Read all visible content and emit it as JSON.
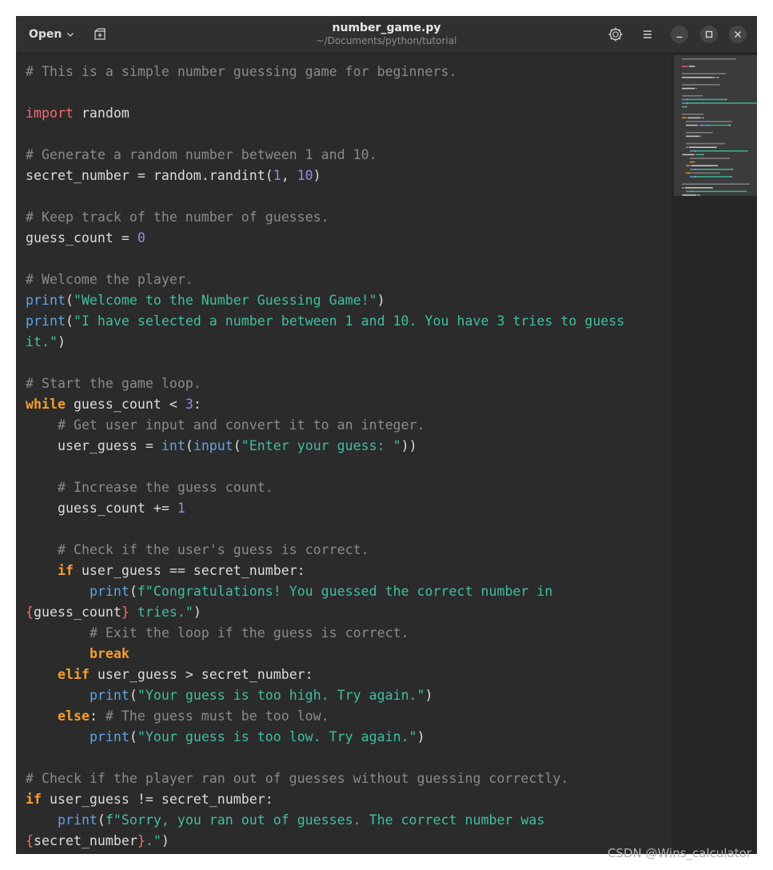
{
  "header": {
    "open_label": "Open",
    "title": "number_game.py",
    "subtitle": "~/Documents/python/tutorial"
  },
  "icons": {
    "open_dropdown": "chevron-down-icon",
    "new_tab": "new-tab-icon",
    "settings": "gear-icon",
    "menu": "hamburger-menu-icon",
    "minimize": "minimize-icon",
    "maximize": "maximize-icon",
    "close": "close-icon"
  },
  "colors": {
    "comment": "#8a8a8a",
    "import": "#f26d6d",
    "keyword": "#f59e2e",
    "function": "#5ea3e6",
    "string": "#3fbfa0",
    "number": "#8f8fe8",
    "text": "#dcdcdc",
    "background": "#2b2b2b"
  },
  "code_lines": [
    [
      {
        "t": "# This is a simple number guessing game for beginners.",
        "k": "com"
      }
    ],
    [],
    [
      {
        "t": "import",
        "k": "imp"
      },
      {
        "t": " random",
        "k": "plain"
      }
    ],
    [],
    [
      {
        "t": "# Generate a random number between 1 and 10.",
        "k": "com"
      }
    ],
    [
      {
        "t": "secret_number = random.randint(",
        "k": "plain"
      },
      {
        "t": "1",
        "k": "num"
      },
      {
        "t": ", ",
        "k": "plain"
      },
      {
        "t": "10",
        "k": "num"
      },
      {
        "t": ")",
        "k": "plain"
      }
    ],
    [],
    [
      {
        "t": "# Keep track of the number of guesses.",
        "k": "com"
      }
    ],
    [
      {
        "t": "guess_count = ",
        "k": "plain"
      },
      {
        "t": "0",
        "k": "num"
      }
    ],
    [],
    [
      {
        "t": "# Welcome the player.",
        "k": "com"
      }
    ],
    [
      {
        "t": "print",
        "k": "fn"
      },
      {
        "t": "(",
        "k": "plain"
      },
      {
        "t": "\"Welcome to the Number Guessing Game!\"",
        "k": "str"
      },
      {
        "t": ")",
        "k": "plain"
      }
    ],
    [
      {
        "t": "print",
        "k": "fn"
      },
      {
        "t": "(",
        "k": "plain"
      },
      {
        "t": "\"I have selected a number between 1 and 10. You have 3 tries to guess",
        "k": "str"
      }
    ],
    [
      {
        "t": "it.\"",
        "k": "str"
      },
      {
        "t": ")",
        "k": "plain"
      }
    ],
    [],
    [
      {
        "t": "# Start the game loop.",
        "k": "com"
      }
    ],
    [
      {
        "t": "while",
        "k": "kw"
      },
      {
        "t": " guess_count < ",
        "k": "plain"
      },
      {
        "t": "3",
        "k": "num"
      },
      {
        "t": ":",
        "k": "plain"
      }
    ],
    [
      {
        "t": "    ",
        "k": "plain"
      },
      {
        "t": "# Get user input and convert it to an integer.",
        "k": "com"
      }
    ],
    [
      {
        "t": "    user_guess = ",
        "k": "plain"
      },
      {
        "t": "int",
        "k": "fn"
      },
      {
        "t": "(",
        "k": "plain"
      },
      {
        "t": "input",
        "k": "fn"
      },
      {
        "t": "(",
        "k": "plain"
      },
      {
        "t": "\"Enter your guess: \"",
        "k": "str"
      },
      {
        "t": "))",
        "k": "plain"
      }
    ],
    [],
    [
      {
        "t": "    ",
        "k": "plain"
      },
      {
        "t": "# Increase the guess count.",
        "k": "com"
      }
    ],
    [
      {
        "t": "    guess_count += ",
        "k": "plain"
      },
      {
        "t": "1",
        "k": "num"
      }
    ],
    [],
    [
      {
        "t": "    ",
        "k": "plain"
      },
      {
        "t": "# Check if the user's guess is correct.",
        "k": "com"
      }
    ],
    [
      {
        "t": "    ",
        "k": "plain"
      },
      {
        "t": "if",
        "k": "kw"
      },
      {
        "t": " user_guess == secret_number:",
        "k": "plain"
      }
    ],
    [
      {
        "t": "        ",
        "k": "plain"
      },
      {
        "t": "print",
        "k": "fn"
      },
      {
        "t": "(",
        "k": "plain"
      },
      {
        "t": "f\"Congratulations! You guessed the correct number in",
        "k": "str"
      }
    ],
    [
      {
        "t": "{",
        "k": "imp"
      },
      {
        "t": "guess_count",
        "k": "plain"
      },
      {
        "t": "}",
        "k": "imp"
      },
      {
        "t": " tries.\"",
        "k": "str"
      },
      {
        "t": ")",
        "k": "plain"
      }
    ],
    [
      {
        "t": "        ",
        "k": "plain"
      },
      {
        "t": "# Exit the loop if the guess is correct.",
        "k": "com"
      }
    ],
    [
      {
        "t": "        ",
        "k": "plain"
      },
      {
        "t": "break",
        "k": "kw"
      }
    ],
    [
      {
        "t": "    ",
        "k": "plain"
      },
      {
        "t": "elif",
        "k": "kw"
      },
      {
        "t": " user_guess > secret_number:",
        "k": "plain"
      }
    ],
    [
      {
        "t": "        ",
        "k": "plain"
      },
      {
        "t": "print",
        "k": "fn"
      },
      {
        "t": "(",
        "k": "plain"
      },
      {
        "t": "\"Your guess is too high. Try again.\"",
        "k": "str"
      },
      {
        "t": ")",
        "k": "plain"
      }
    ],
    [
      {
        "t": "    ",
        "k": "plain"
      },
      {
        "t": "else",
        "k": "kw"
      },
      {
        "t": ": ",
        "k": "plain"
      },
      {
        "t": "# The guess must be too low.",
        "k": "com"
      }
    ],
    [
      {
        "t": "        ",
        "k": "plain"
      },
      {
        "t": "print",
        "k": "fn"
      },
      {
        "t": "(",
        "k": "plain"
      },
      {
        "t": "\"Your guess is too low. Try again.\"",
        "k": "str"
      },
      {
        "t": ")",
        "k": "plain"
      }
    ],
    [],
    [
      {
        "t": "# Check if the player ran out of guesses without guessing correctly.",
        "k": "com"
      }
    ],
    [
      {
        "t": "if",
        "k": "kw"
      },
      {
        "t": " user_guess != secret_number:",
        "k": "plain"
      }
    ],
    [
      {
        "t": "    ",
        "k": "plain"
      },
      {
        "t": "print",
        "k": "fn"
      },
      {
        "t": "(",
        "k": "plain"
      },
      {
        "t": "f\"Sorry, you ran out of guesses. The correct number was",
        "k": "str"
      }
    ],
    [
      {
        "t": "{",
        "k": "imp"
      },
      {
        "t": "secret_number",
        "k": "plain"
      },
      {
        "t": "}",
        "k": "imp"
      },
      {
        "t": ".\"",
        "k": "str"
      },
      {
        "t": ")",
        "k": "plain"
      }
    ]
  ],
  "watermark": "CSDN @Wins_calculator"
}
